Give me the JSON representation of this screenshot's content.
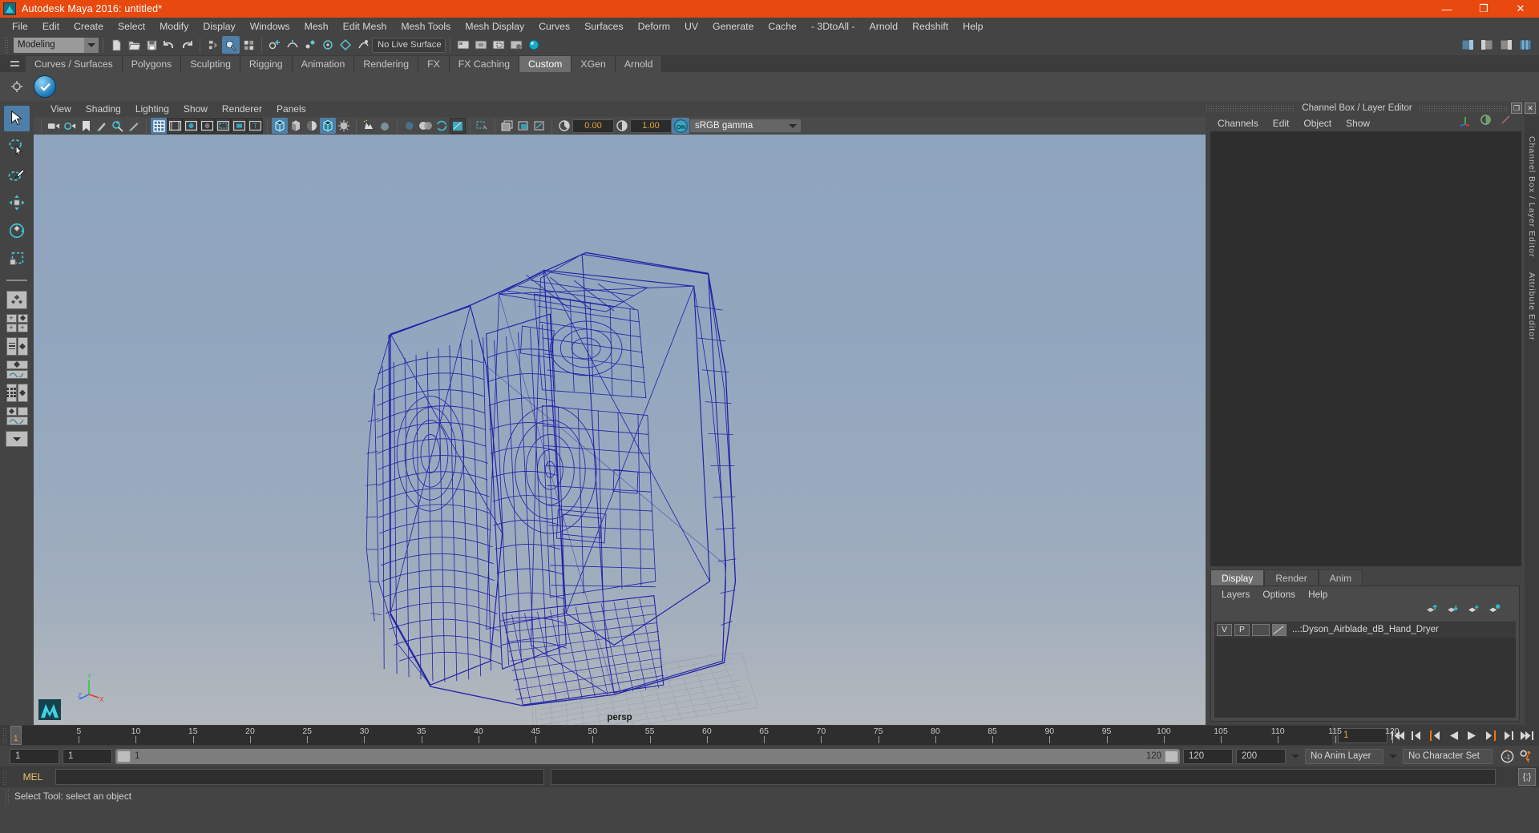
{
  "window": {
    "title": "Autodesk Maya 2016: untitled*",
    "app_icon": "maya-logo-icon",
    "buttons": [
      {
        "name": "minimize",
        "glyph": "—"
      },
      {
        "name": "maximize",
        "glyph": "❐"
      },
      {
        "name": "close",
        "glyph": "✕"
      }
    ],
    "titlebar_color": "#e8490f"
  },
  "menubar": {
    "items": [
      "File",
      "Edit",
      "Create",
      "Select",
      "Modify",
      "Display",
      "Windows",
      "Mesh",
      "Edit Mesh",
      "Mesh Tools",
      "Mesh Display",
      "Curves",
      "Surfaces",
      "Deform",
      "UV",
      "Generate",
      "Cache",
      "- 3DtoAll -",
      "Arnold",
      "Redshift",
      "Help"
    ]
  },
  "statusbar": {
    "mode_selector": "Modeling",
    "live_surface": "No Live Surface",
    "icons": [
      "new-scene-icon",
      "open-scene-icon",
      "save-scene-icon",
      "undo-icon",
      "redo-icon",
      "select-by-hierarchy-icon",
      "select-by-object-icon",
      "select-by-component-icon",
      "snap-to-grid-icon",
      "snap-to-curve-icon",
      "snap-to-point-icon",
      "snap-to-projected-center-icon",
      "snap-to-view-plane-icon",
      "make-live-icon",
      "render-current-frame-icon",
      "ipr-render-icon",
      "render-settings-icon",
      "hypershade-icon",
      "toggle-sidebar-icon"
    ]
  },
  "shelf": {
    "tabs": [
      "Curves / Surfaces",
      "Polygons",
      "Sculpting",
      "Rigging",
      "Animation",
      "Rendering",
      "FX",
      "FX Caching",
      "Custom",
      "XGen",
      "Arnold"
    ],
    "active_tab": "Custom",
    "button_icon": "blue-sphere-shelf-icon"
  },
  "toolbox": {
    "tools": [
      {
        "name": "select-tool",
        "glyph": "arrow",
        "selected": true
      },
      {
        "name": "lasso-select-tool",
        "glyph": "lasso",
        "selected": false
      },
      {
        "name": "paint-select-tool",
        "glyph": "brush",
        "selected": false
      },
      {
        "name": "move-tool",
        "glyph": "move",
        "selected": false
      },
      {
        "name": "rotate-tool",
        "glyph": "rotate",
        "selected": false
      },
      {
        "name": "scale-tool",
        "glyph": "scale",
        "selected": false
      }
    ],
    "layouts": [
      "single-perspective-layout",
      "four-view-layout",
      "outliner-persp-layout",
      "persp-graph-layout",
      "hypershade-persp-layout",
      "persp-graph-outliner-layout",
      "more-layouts"
    ]
  },
  "viewport": {
    "menus": [
      "View",
      "Shading",
      "Lighting",
      "Show",
      "Renderer",
      "Panels"
    ],
    "toolbar": {
      "exposure": "0.00",
      "gamma": "1.00",
      "view_transform": "sRGB gamma",
      "view_transform_enabled": "ON",
      "icons": [
        "select-camera-icon",
        "camera-attributes-icon",
        "bookmark-icon",
        "image-plane-icon",
        "two-d-pan-zoom-icon",
        "grease-pencil-icon",
        "grid-icon",
        "film-gate-icon",
        "resolution-gate-icon",
        "gate-mask-icon",
        "film-origin-icon",
        "safe-action-icon",
        "safe-title-icon",
        "wireframe-icon",
        "smooth-shade-icon",
        "shaded-wireframe-icon",
        "texture-icon",
        "lights-icon",
        "shadows-icon",
        "screen-space-ao-icon",
        "motion-blur-icon",
        "multisample-icon",
        "isolate-select-icon",
        "xray-icon",
        "xray-joints-icon",
        "xray-active-components-icon",
        "exposure-icon",
        "gamma-icon"
      ]
    },
    "camera_label": "persp",
    "axis_labels": {
      "y": "Y",
      "z": "Z",
      "x": "X"
    },
    "object": "Dyson Airblade dB Hand Dryer wireframe",
    "wireframe_color": "#1d1ca8",
    "bg_top": "#8fa4bd",
    "bg_bottom": "#b5b9bc"
  },
  "right_panel": {
    "title": "Channel Box / Layer Editor",
    "window_buttons": [
      "undock-icon",
      "close-icon"
    ],
    "channelbox": {
      "menus": [
        "Channels",
        "Edit",
        "Object",
        "Show"
      ],
      "corner_icons": [
        "axis-toggle-icon",
        "sphere-toggle-icon",
        "slash-toggle-icon"
      ],
      "content": ""
    },
    "layer_editor": {
      "tabs": [
        "Display",
        "Render",
        "Anim"
      ],
      "active_tab": "Display",
      "menus": [
        "Layers",
        "Options",
        "Help"
      ],
      "arrow_icons": [
        "move-layer-up-icon",
        "move-layer-down-icon",
        "new-layer-icon",
        "new-layer-from-selected-icon"
      ],
      "layers": [
        {
          "visibility": "V",
          "playback": "P",
          "color": "",
          "name": "...:Dyson_Airblade_dB_Hand_Dryer"
        }
      ]
    },
    "side_tabs": [
      "Channel Box / Layer Editor",
      "Attribute Editor"
    ]
  },
  "timeline": {
    "tick_labels": [
      "5",
      "10",
      "15",
      "20",
      "25",
      "30",
      "35",
      "40",
      "45",
      "50",
      "55",
      "60",
      "65",
      "70",
      "75",
      "80",
      "85",
      "90",
      "95",
      "100",
      "105",
      "110",
      "115",
      "120"
    ],
    "current_frame": "1",
    "current_frame_field": "1",
    "playback_buttons": [
      "go-to-start-icon",
      "step-back-keyframe-icon",
      "step-back-frame-icon",
      "play-backwards-icon",
      "play-forwards-icon",
      "step-forward-frame-icon",
      "step-forward-keyframe-icon",
      "go-to-end-icon"
    ],
    "range": {
      "start": "1",
      "playback_start": "1",
      "slider_start_label": "1",
      "slider_end_label": "120",
      "playback_end": "120",
      "end": "200",
      "anim_layer": "No Anim Layer",
      "character_set": "No Character Set",
      "auto_key_icon": "auto-keyframe-icon",
      "anim_prefs_icon": "animation-preferences-icon"
    }
  },
  "command_line": {
    "language": "MEL",
    "input_value": "",
    "output_value": "",
    "script_editor_icon": "script-editor-icon"
  },
  "help_line": {
    "text": "Select Tool: select an object"
  }
}
